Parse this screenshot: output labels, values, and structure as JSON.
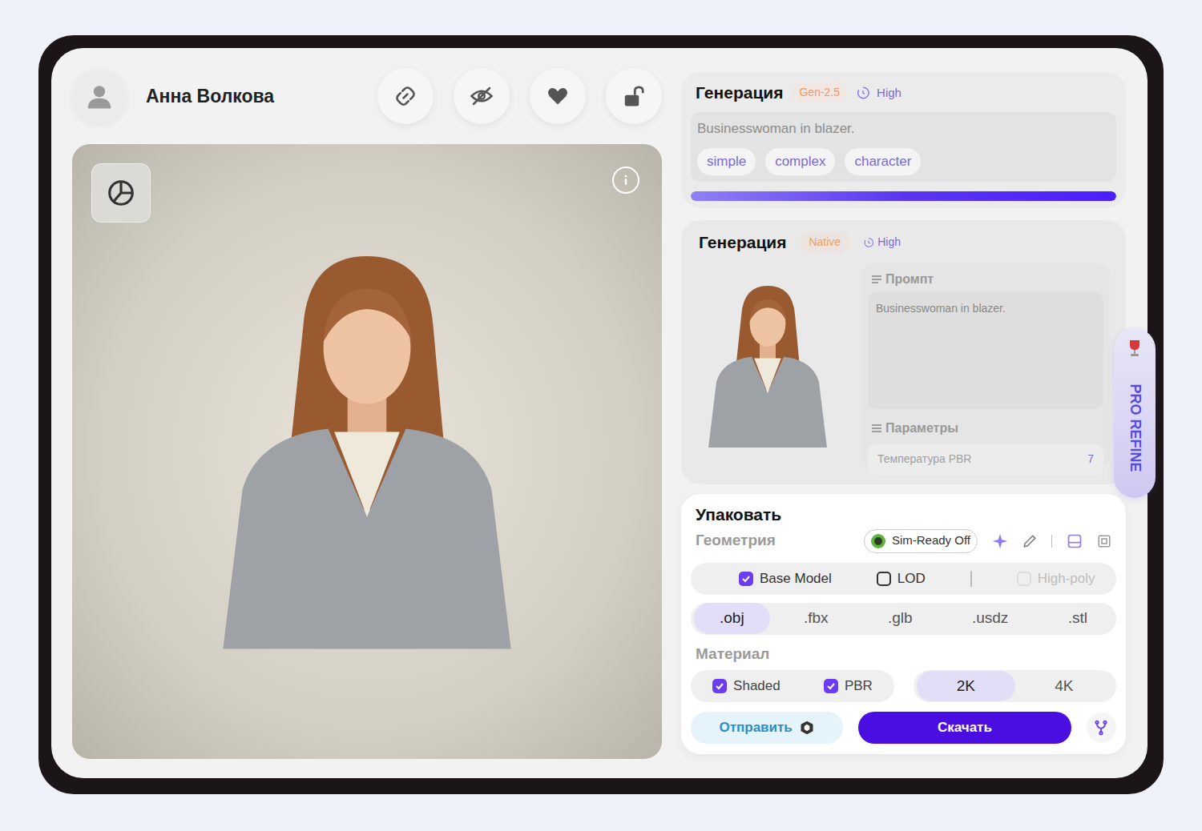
{
  "user": {
    "name": "Анна Волкова"
  },
  "generation_main": {
    "title": "Генерация",
    "model": "Gen-2.5",
    "quality": "High",
    "prompt": "Businesswoman in blazer.",
    "chips": [
      "simple",
      "complex",
      "character"
    ],
    "progress": {
      "level": 1
    }
  },
  "generation_native": {
    "title": "Генерация",
    "model": "Native",
    "quality": "High",
    "prompt_label": "Промпт",
    "prompt": "Businesswoman in blazer.",
    "params_label": "Параметры",
    "params": [
      {
        "label": "Температура PBR",
        "value": "7"
      }
    ]
  },
  "pro_refine": {
    "label": "PRO REFINE"
  },
  "pack": {
    "title": "Упаковать",
    "geometry_label": "Геометрия",
    "sim_ready": {
      "label": "Sim-Ready Off",
      "on": false
    },
    "geometry_options": [
      {
        "label": "Base Model",
        "checked": true,
        "disabled": false
      },
      {
        "label": "LOD",
        "checked": false,
        "disabled": false
      },
      {
        "label": "High-poly",
        "checked": false,
        "disabled": true
      }
    ],
    "formats": [
      {
        "label": ".obj",
        "selected": true
      },
      {
        "label": ".fbx",
        "selected": false
      },
      {
        "label": ".glb",
        "selected": false
      },
      {
        "label": ".usdz",
        "selected": false
      },
      {
        "label": ".stl",
        "selected": false
      }
    ],
    "material_label": "Материал",
    "material_options": [
      {
        "label": "Shaded",
        "checked": true
      },
      {
        "label": "PBR",
        "checked": true
      }
    ],
    "resolutions": [
      {
        "label": "2K",
        "selected": true
      },
      {
        "label": "4K",
        "selected": false
      }
    ],
    "send_button": "Отправить",
    "download_button": "Скачать"
  }
}
